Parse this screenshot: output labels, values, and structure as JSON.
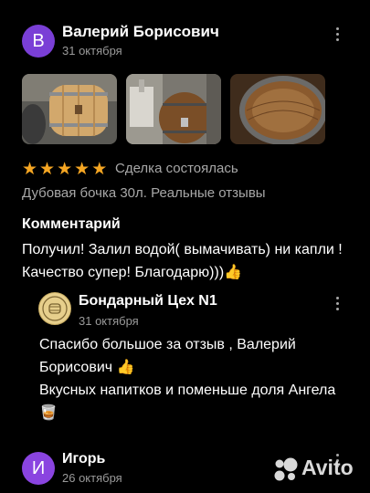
{
  "review1": {
    "avatar_letter": "В",
    "author": "Валерий Борисович",
    "date": "31 октября",
    "rating": 5,
    "deal_status": "Сделка состоялась",
    "product": "Дубовая бочка 30л. Реальные отзывы",
    "comment_title": "Комментарий",
    "comment": "Получил! Залил водой( вымачивать) ни капли ! Качество супер! Благодарю)))👍"
  },
  "reply": {
    "author": "Бондарный Цех N1",
    "date": "31 октября",
    "text_line1": "Спасибо большое за отзыв , Валерий Борисович 👍",
    "text_line2": "Вкусных напитков и поменьше доля Ангела 🥃"
  },
  "review2": {
    "avatar_letter": "И",
    "author": "Игорь",
    "date": "26 октября"
  },
  "colors": {
    "avatar_b": "#7a3fd6",
    "avatar_i": "#8a44e0",
    "star": "#f5a623"
  },
  "watermark": "Avito"
}
